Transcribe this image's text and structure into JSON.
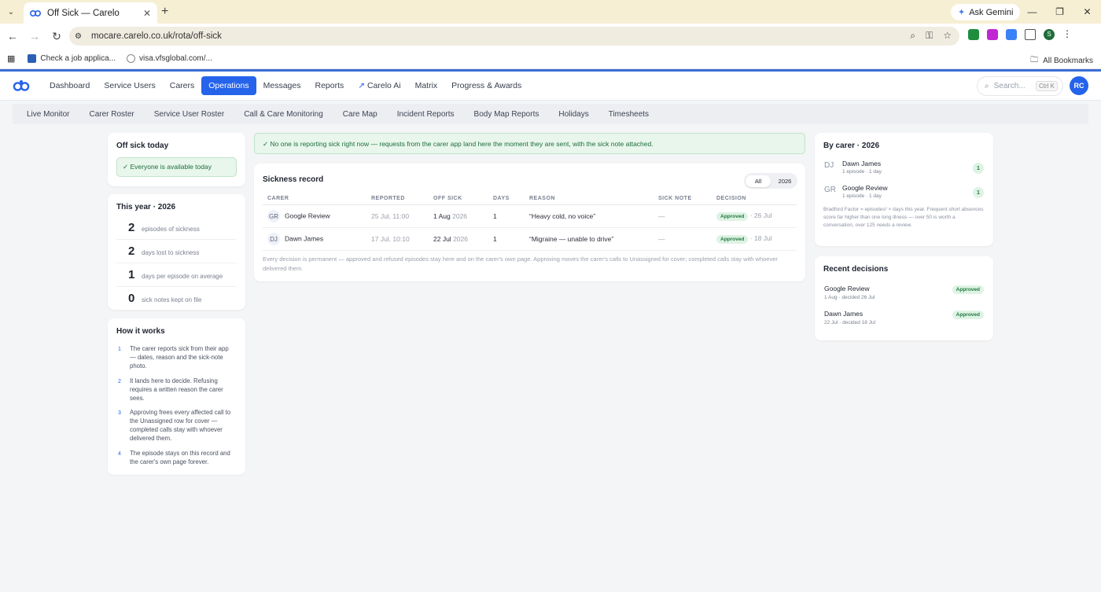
{
  "browser": {
    "tab_title": "Off Sick — Carelo",
    "url": "mocare.carelo.co.uk/rota/off-sick",
    "ask_gemini": "Ask Gemini",
    "bookmarks": [
      "Check a job applica...",
      "visa.vfsglobal.com/..."
    ],
    "all_bookmarks": "All Bookmarks",
    "profile_initial": "S"
  },
  "app": {
    "nav": [
      "Dashboard",
      "Service Users",
      "Carers",
      "Operations",
      "Messages",
      "Reports",
      "Carelo Ai",
      "Matrix",
      "Progress & Awards"
    ],
    "active_nav": "Operations",
    "search_placeholder": "Search...",
    "search_shortcut": "Ctrl K",
    "user_initials": "RC",
    "subnav": [
      "Live Monitor",
      "Carer Roster",
      "Service User Roster",
      "Call & Care Monitoring",
      "Care Map",
      "Incident Reports",
      "Body Map Reports",
      "Holidays",
      "Timesheets"
    ]
  },
  "off_sick_today": {
    "title": "Off sick today",
    "status": "✓ Everyone is available today"
  },
  "this_year": {
    "title": "This year · 2026",
    "stats": [
      {
        "num": "2",
        "label": "episodes of sickness"
      },
      {
        "num": "2",
        "label": "days lost to sickness"
      },
      {
        "num": "1",
        "label": "days per episode on average"
      },
      {
        "num": "0",
        "label": "sick notes kept on file"
      }
    ]
  },
  "how_it_works": {
    "title": "How it works",
    "steps": [
      "The carer reports sick from their app — dates, reason and the sick-note photo.",
      "It lands here to decide. Refusing requires a written reason the carer sees.",
      "Approving frees every affected call to the Unassigned row for cover — completed calls stay with whoever delivered them.",
      "The episode stays on this record and the carer's own page forever."
    ]
  },
  "banner": "✓ No one is reporting sick right now — requests from the carer app land here the moment they are sent, with the sick note attached.",
  "sickness_record": {
    "title": "Sickness record",
    "filters": [
      "All",
      "2026"
    ],
    "columns": [
      "CARER",
      "REPORTED",
      "OFF SICK",
      "DAYS",
      "REASON",
      "SICK NOTE",
      "DECISION"
    ],
    "rows": [
      {
        "initials": "GR",
        "carer": "Google Review",
        "reported": "25 Jul, 11:00",
        "off_date": "1 Aug",
        "off_year": "2026",
        "days": "1",
        "reason": "“Heavy cold, no voice”",
        "note": "—",
        "decision": "Approved",
        "decision_date": "· 26 Jul"
      },
      {
        "initials": "DJ",
        "carer": "Dawn James",
        "reported": "17 Jul, 10:10",
        "off_date": "22 Jul",
        "off_year": "2026",
        "days": "1",
        "reason": "“Migraine — unable to drive”",
        "note": "—",
        "decision": "Approved",
        "decision_date": "· 18 Jul"
      }
    ],
    "footnote": "Every decision is permanent — approved and refused episodes stay here and on the carer's own page. Approving moves the carer's calls to Unassigned for cover; completed calls stay with whoever delivered them."
  },
  "by_carer": {
    "title": "By carer · 2026",
    "items": [
      {
        "initials": "DJ",
        "name": "Dawn James",
        "sub": "1 episode · 1 day",
        "count": "1"
      },
      {
        "initials": "GR",
        "name": "Google Review",
        "sub": "1 episode · 1 day",
        "count": "1"
      }
    ],
    "note": "Bradford Factor = episodes² × days this year. Frequent short absences score far higher than one long illness — over 50 is worth a conversation, over 125 needs a review."
  },
  "recent_decisions": {
    "title": "Recent decisions",
    "items": [
      {
        "name": "Google Review",
        "sub": "1 Aug · decided 26 Jul",
        "status": "Approved"
      },
      {
        "name": "Dawn James",
        "sub": "22 Jul · decided 18 Jul",
        "status": "Approved"
      }
    ]
  },
  "colors": {
    "accent": "#2563eb",
    "success": "#1f7a3d",
    "chrome": "#f6efd3"
  }
}
